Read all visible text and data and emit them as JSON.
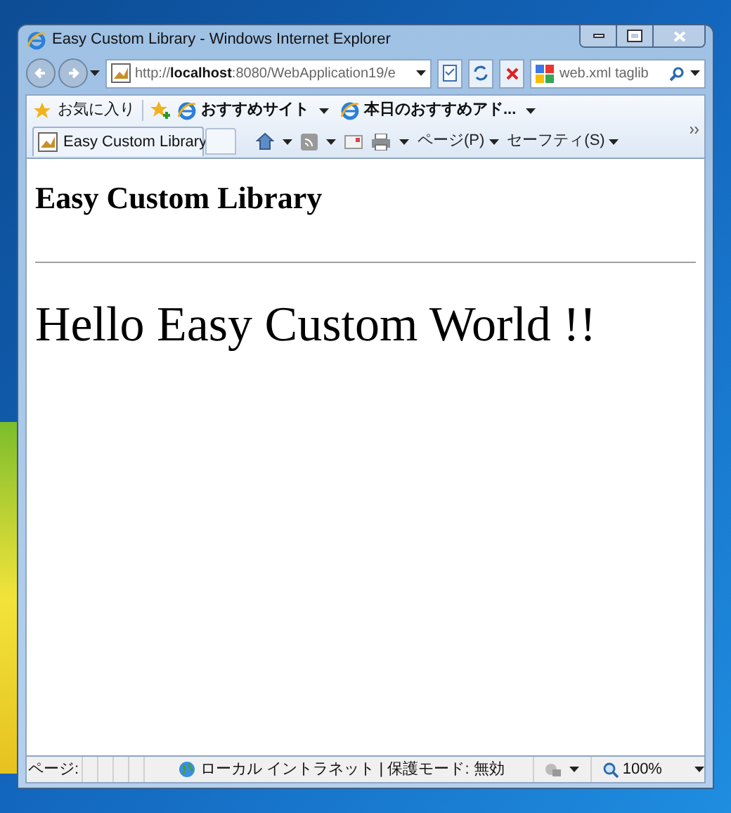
{
  "window": {
    "title": "Easy Custom Library - Windows Internet Explorer"
  },
  "address_bar": {
    "url": "http://**localhost**:8080/WebApplication19/e"
  },
  "search": {
    "value": "web.xml taglib"
  },
  "favorites_bar": {
    "favorites": "お気に入り",
    "links": [
      {
        "label": "おすすめサイト"
      },
      {
        "label": "本日のおすすめアド..."
      }
    ]
  },
  "tabs": [
    {
      "label": "Easy Custom Library",
      "selected": true
    }
  ],
  "command_bar": {
    "menus": [
      "ページ(P)",
      "セーフティ(S)"
    ]
  },
  "page": {
    "heading": "Easy Custom Library",
    "message": "Hello Easy Custom World !!"
  },
  "status_bar": {
    "text": "ページ:",
    "zone": "ローカル イントラネット | 保護モード: 無効",
    "zoom": "100%"
  }
}
